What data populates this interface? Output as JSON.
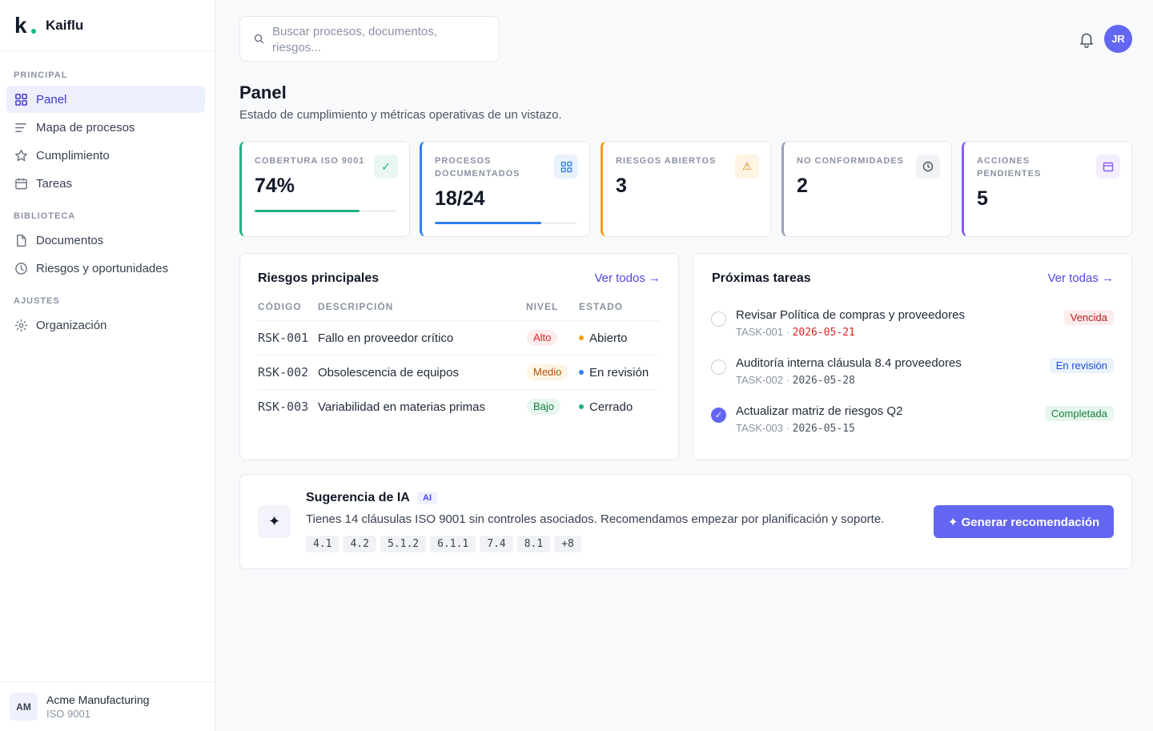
{
  "brand": {
    "mark": "k",
    "name": "Kaiflu"
  },
  "sidebar": {
    "sections": [
      {
        "label": "PRINCIPAL",
        "items": [
          {
            "label": "Panel",
            "icon": "grid-icon",
            "active": true
          },
          {
            "label": "Mapa de procesos",
            "icon": "lines-icon"
          },
          {
            "label": "Cumplimiento",
            "icon": "star-icon"
          },
          {
            "label": "Tareas",
            "icon": "calendar-icon"
          }
        ]
      },
      {
        "label": "BIBLIOTECA",
        "items": [
          {
            "label": "Documentos",
            "icon": "file-icon"
          },
          {
            "label": "Riesgos y oportunidades",
            "icon": "clock-icon"
          }
        ]
      },
      {
        "label": "AJUSTES",
        "items": [
          {
            "label": "Organización",
            "icon": "gear-icon"
          }
        ]
      }
    ],
    "org": {
      "initials": "AM",
      "name": "Acme Manufacturing",
      "standard": "ISO 9001"
    }
  },
  "header": {
    "search_placeholder_line1": "Buscar procesos, documentos,",
    "search_placeholder_line2": "riesgos...",
    "user_initials": "JR"
  },
  "page": {
    "title": "Panel",
    "subtitle": "Estado de cumplimiento y métricas operativas de un vistazo."
  },
  "kpis": [
    {
      "label": "COBERTURA ISO 9001",
      "value": "74%",
      "progress": 0.74,
      "accent": "#22b07d",
      "icon": "check-icon",
      "glyph": "✓"
    },
    {
      "label": "PROCESOS DOCUMENTADOS",
      "value": "18/24",
      "progress": 0.75,
      "accent": "#2f80ed",
      "icon": "grid-icon",
      "glyph": ""
    },
    {
      "label": "RIESGOS ABIERTOS",
      "value": "3",
      "accent": "#f59e0b",
      "icon": "warning-icon",
      "glyph": "⚠"
    },
    {
      "label": "NO CONFORMIDADES",
      "value": "2",
      "accent": "#94a3b8",
      "icon": "clock-icon",
      "glyph": ""
    },
    {
      "label": "ACCIONES PENDIENTES",
      "value": "5",
      "accent": "#8b5cf6",
      "icon": "calendar-icon",
      "glyph": ""
    }
  ],
  "risks": {
    "title": "Riesgos principales",
    "link": "Ver todos →",
    "headers": {
      "code": "CÓDIGO",
      "desc": "DESCRIPCIÓN",
      "level": "NIVEL",
      "status": "ESTADO"
    },
    "rows": [
      {
        "code": "RSK-001",
        "desc": "Fallo en proveedor crítico",
        "level": "Alto",
        "status": "Abierto"
      },
      {
        "code": "RSK-002",
        "desc": "Obsolescencia de equipos",
        "level": "Medio",
        "status": "En revisión"
      },
      {
        "code": "RSK-003",
        "desc": "Variabilidad en materias primas",
        "level": "Bajo",
        "status": "Cerrado"
      }
    ]
  },
  "tasks": {
    "title": "Próximas tareas",
    "link": "Ver todas →",
    "items": [
      {
        "title": "Revisar Política de compras y proveedores",
        "id": "TASK-001",
        "date": "2026-05-21",
        "badge": "Vencida",
        "done": false
      },
      {
        "title": "Auditoría interna cláusula 8.4 proveedores",
        "id": "TASK-002",
        "date": "2026-05-28",
        "badge": "En revisión",
        "done": false
      },
      {
        "title": "Actualizar matriz de riesgos Q2",
        "id": "TASK-003",
        "date": "2026-05-15",
        "badge": "Completada",
        "done": true
      }
    ]
  },
  "ai": {
    "icon_glyph": "✦",
    "title": "Sugerencia de IA",
    "tag": "AI",
    "text": "Tienes 14 cláusulas ISO 9001 sin controles asociados. Recomendamos empezar por planificación y soporte.",
    "chips": [
      "4.1",
      "4.2",
      "5.1.2",
      "6.1.1",
      "7.4",
      "8.1",
      "+8"
    ],
    "button": "✦ Generar recomendación"
  },
  "meta_sep": " · "
}
